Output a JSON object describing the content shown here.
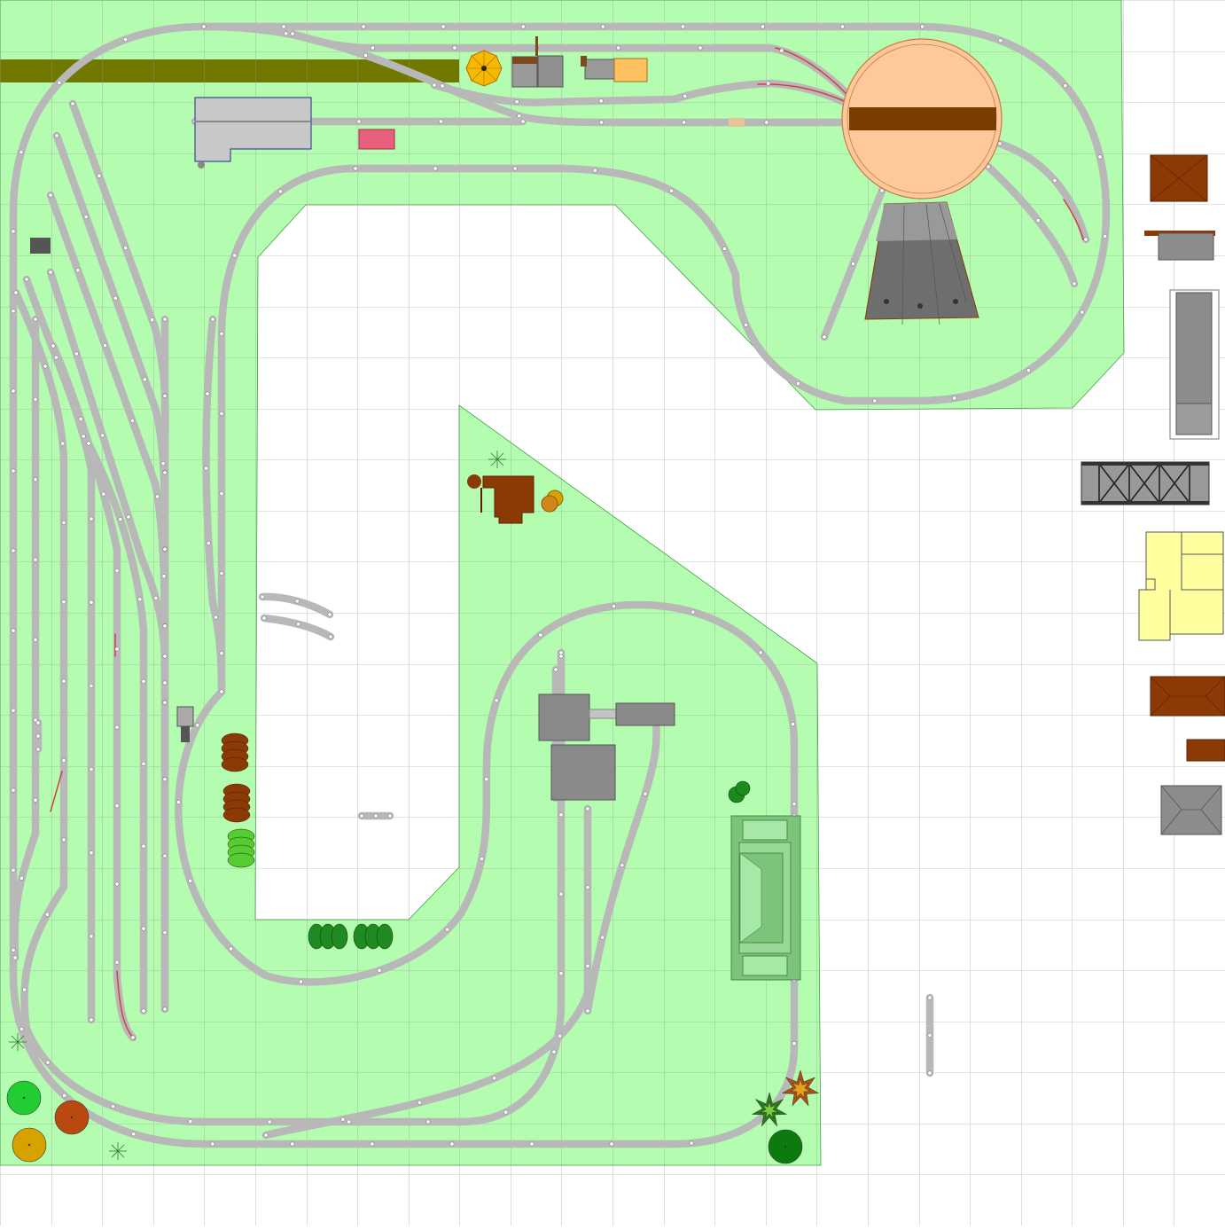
{
  "plan": {
    "colors": {
      "grid": "#9a9a9a",
      "board": "#b4fcb0",
      "track": "#b8b8b8",
      "track_edge": "#808080",
      "joint": "#ffffff",
      "siding_red": "#d04040",
      "turntable": "#fdc89a",
      "bridge": "#7a3c00",
      "olive": "#707800",
      "brown": "#8b3a05",
      "gray": "#8c8c8c",
      "yellow": "#ffffa0"
    }
  },
  "catalog": {
    "trees": [
      {
        "icon": "deciduous-tree-icon",
        "color": "#22cc33"
      },
      {
        "icon": "deciduous-tree-icon",
        "color": "#b84a10"
      },
      {
        "icon": "deciduous-tree-icon",
        "color": "#d7a200"
      },
      {
        "icon": "deciduous-tree-icon",
        "color": "#0d7a10"
      }
    ],
    "conifers": [
      {
        "icon": "pine-tree-icon"
      },
      {
        "icon": "pine-tree-icon"
      },
      {
        "icon": "pine-tree-icon"
      }
    ],
    "buildings": [
      {
        "icon": "roof-building-icon",
        "color": "#8b3a05"
      },
      {
        "icon": "shed-building-icon",
        "color": "#8c8c8c"
      },
      {
        "icon": "station-building-icon",
        "color": "#8c8c8c"
      },
      {
        "icon": "truss-bridge-icon",
        "color": "#8c8c8c"
      },
      {
        "icon": "house-building-icon",
        "color": "#ffffa0"
      },
      {
        "icon": "roof-building-icon",
        "color": "#8b3a05"
      },
      {
        "icon": "small-shed-icon",
        "color": "#8b3a05"
      },
      {
        "icon": "hip-roof-building-icon",
        "color": "#8c8c8c"
      }
    ]
  }
}
